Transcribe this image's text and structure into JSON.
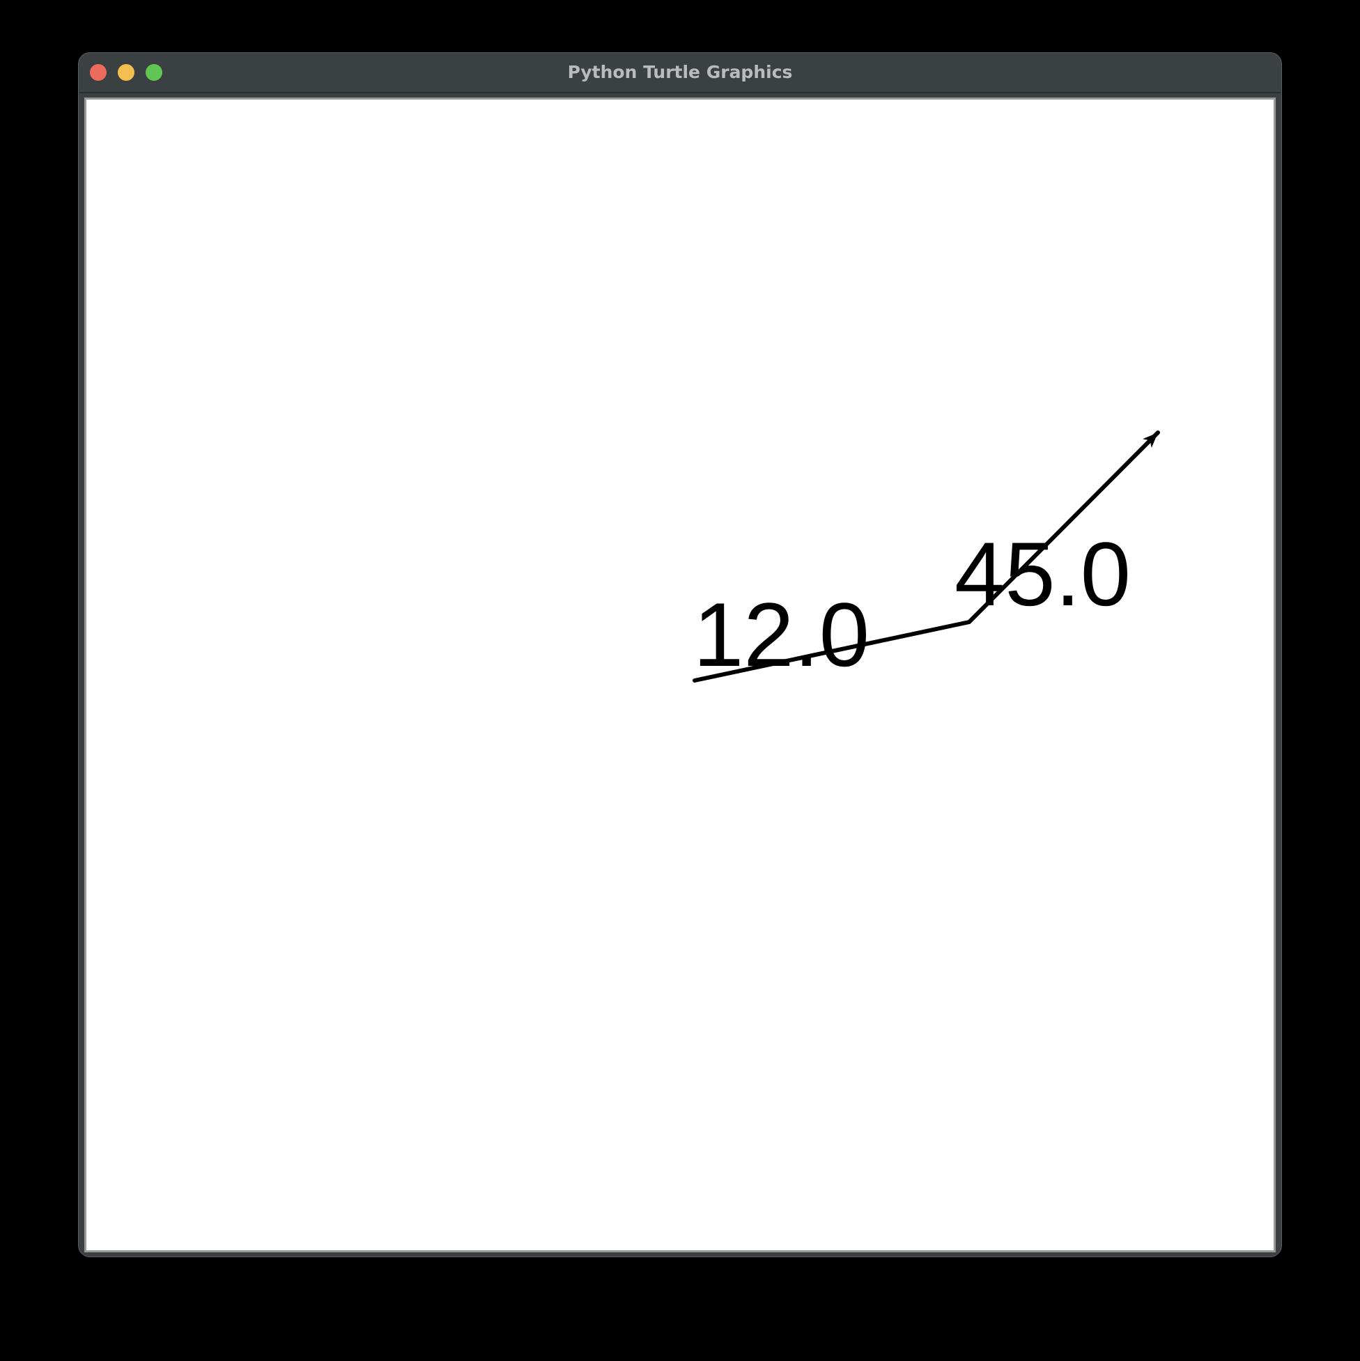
{
  "window": {
    "title": "Python Turtle Graphics",
    "controls": {
      "close_color": "#ed6a5e",
      "minimize_color": "#f5bf4f",
      "zoom_color": "#61c554"
    }
  },
  "canvas": {
    "background": "#ffffff",
    "pen_color": "#000000",
    "labels": [
      "12.0",
      "45.0"
    ],
    "turtle_heading_deg": 45
  }
}
